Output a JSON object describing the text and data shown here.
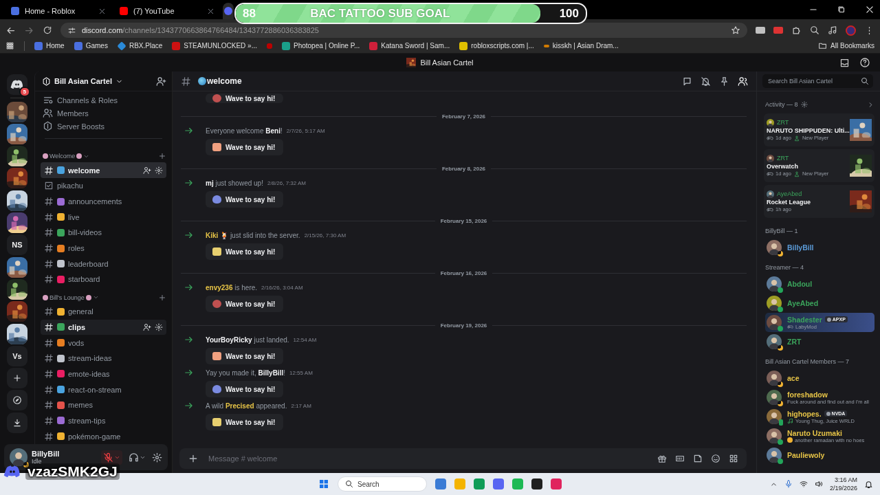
{
  "browser": {
    "tabs": [
      {
        "title": "Home - Roblox",
        "selected": false
      },
      {
        "title": "(7) YouTube",
        "selected": false
      },
      {
        "selected": true
      }
    ],
    "url": {
      "host": "discord.com",
      "path": "/channels/1343770663864766484/1343772886036383825"
    },
    "bookmarks": [
      "Home",
      "Games",
      "RBX.Place",
      "STEAMUNLOCKED »...",
      "Photopea | Online P...",
      "Katana Sword | Sam...",
      "robloxscripts.com |...",
      "kisskh | Asian Dram..."
    ],
    "all_bookmarks": "All Bookmarks"
  },
  "sub_goal": {
    "current": "88",
    "title": "BAC TATTOO SUB GOAL",
    "goal": "100",
    "level": 0.87
  },
  "app_title": "Bill Asian Cartel",
  "server_rail": {
    "badge": "5",
    "servers": [
      {
        "kind": "picture"
      },
      {
        "kind": "picture"
      },
      {
        "kind": "picture"
      },
      {
        "kind": "picture"
      },
      {
        "kind": "picture"
      },
      {
        "kind": "picture"
      },
      {
        "kind": "text",
        "label": "NS"
      },
      {
        "kind": "picture"
      },
      {
        "kind": "picture"
      },
      {
        "kind": "picture"
      },
      {
        "kind": "picture"
      },
      {
        "kind": "text",
        "label": "Vs"
      }
    ]
  },
  "channels": {
    "server_name": "Bill Asian Cartel",
    "menu": [
      "Channels & Roles",
      "Members",
      "Server Boosts"
    ],
    "categories": [
      {
        "name": "Welcome",
        "channels": [
          {
            "name": "welcome",
            "kind": "text",
            "selected": true,
            "hovered": false
          },
          {
            "name": "pikachu",
            "kind": "forum",
            "selected": false,
            "hovered": false
          },
          {
            "name": "announcements",
            "kind": "text",
            "selected": false,
            "hovered": false
          },
          {
            "name": "live",
            "kind": "text",
            "selected": false,
            "hovered": false
          },
          {
            "name": "bill-videos",
            "kind": "text",
            "selected": false,
            "hovered": false
          },
          {
            "name": "roles",
            "kind": "text",
            "selected": false,
            "hovered": false
          },
          {
            "name": "leaderboard",
            "kind": "text",
            "selected": false,
            "hovered": false
          },
          {
            "name": "starboard",
            "kind": "text",
            "selected": false,
            "hovered": false
          }
        ]
      },
      {
        "name": "Bill's Lounge",
        "channels": [
          {
            "name": "general",
            "kind": "text",
            "selected": false,
            "hovered": false
          },
          {
            "name": "clips",
            "kind": "text",
            "selected": false,
            "hovered": true
          },
          {
            "name": "vods",
            "kind": "text",
            "selected": false,
            "hovered": false
          },
          {
            "name": "stream-ideas",
            "kind": "text",
            "selected": false,
            "hovered": false
          },
          {
            "name": "emote-ideas",
            "kind": "text",
            "selected": false,
            "hovered": false
          },
          {
            "name": "react-on-stream",
            "kind": "text",
            "selected": false,
            "hovered": false
          },
          {
            "name": "memes",
            "kind": "text",
            "selected": false,
            "hovered": false
          },
          {
            "name": "stream-tips",
            "kind": "text",
            "selected": false,
            "hovered": false
          },
          {
            "name": "pokémon-game",
            "kind": "text",
            "selected": false,
            "hovered": false
          }
        ]
      }
    ]
  },
  "user": {
    "name": "BillyBill",
    "status": "Idle",
    "presence": {
      "kind": "idle"
    },
    "muted": true
  },
  "chat": {
    "channel": "welcome",
    "placeholder": "Message # welcome",
    "messages": [
      {
        "button": "Wave to say hi!"
      },
      {
        "date": "February 7, 2026",
        "before": "Everyone welcome ",
        "name": "Beni",
        "after": "!",
        "color": "#f2f3f5",
        "time": "2/7/26, 5:17 AM",
        "button": "Wave to say hi!"
      },
      {
        "date": "February 8, 2026",
        "name": "mj",
        "after": " just showed up!",
        "color": "#f2f3f5",
        "time": "2/8/26, 7:32 AM",
        "button": "Wave to say hi!"
      },
      {
        "date": "February 15, 2026",
        "name": "Kiki",
        "after": " 🍹 just slid into the server.",
        "color": "#e8c547",
        "time": "2/15/26, 7:30 AM",
        "button": "Wave to say hi!"
      },
      {
        "date": "February 16, 2026",
        "name": "envy236",
        "after": " is here.",
        "color": "#e8c547",
        "time": "2/16/26, 3:04 AM",
        "button": "Wave to say hi!"
      },
      {
        "date": "February 19, 2026",
        "name": "YourBoyRicky",
        "after": " just landed.",
        "color": "#f2f3f5",
        "time": "12:54 AM",
        "button": "Wave to say hi!"
      },
      {
        "before": "Yay you made it, ",
        "name": "BillyBill",
        "after": "!",
        "color": "#f2f3f5",
        "time": "12:55 AM",
        "button": "Wave to say hi!"
      },
      {
        "before": "A wild ",
        "name": "Precised",
        "after": " appeared.",
        "color": "#e8c547",
        "time": "2:17 AM",
        "button": "Wave to say hi!"
      }
    ]
  },
  "members": {
    "search_placeholder": "Search Bill Asian Cartel",
    "activity_title": "Activity — 8",
    "activities": [
      {
        "user": "ZRT",
        "game": "NARUTO SHIPPUDEN: Ulti...",
        "time": "1d ago",
        "badge": "New Player"
      },
      {
        "user": "ZRT",
        "game": "Overwatch",
        "time": "1d ago",
        "badge": "New Player"
      },
      {
        "user": "AyeAbed",
        "game": "Rocket League",
        "time": "1h ago"
      }
    ],
    "groups": [
      {
        "title": "BillyBill — 1",
        "members": [
          {
            "name": "BillyBill",
            "color": "#5b9bd8",
            "presence": {
              "kind": "idle"
            },
            "highlighted": false
          }
        ]
      },
      {
        "title": "Streamer — 4",
        "members": [
          {
            "name": "Abdoul",
            "color": "#3ba55c",
            "presence": {
              "kind": "online"
            },
            "highlighted": false
          },
          {
            "name": "AyeAbed",
            "color": "#3ba55c",
            "presence": {
              "kind": "online"
            },
            "highlighted": false
          },
          {
            "name": "Shadester",
            "color": "#3ba55c",
            "presence": {
              "kind": "online"
            },
            "tag": "APXP",
            "activity": {
              "kind": "game",
              "text": "LabyMod"
            },
            "highlighted": true
          },
          {
            "name": "ZRT",
            "color": "#3ba55c",
            "presence": {
              "kind": "idle"
            },
            "highlighted": false
          }
        ]
      },
      {
        "title": "Bill Asian Cartel Members — 7",
        "members": [
          {
            "name": "ace",
            "color": "#e8c547",
            "presence": {
              "kind": "idle"
            },
            "highlighted": false
          },
          {
            "name": "foreshadow",
            "color": "#e8c547",
            "presence": {
              "kind": "idle"
            },
            "activity": {
              "kind": "custom",
              "text": "Fuck around and find out and I'm all"
            },
            "highlighted": false
          },
          {
            "name": "highopes.",
            "color": "#e8c547",
            "presence": {
              "kind": "mobile"
            },
            "tag": "NVDA",
            "activity": {
              "kind": "music",
              "text": "Young Thug, Juice WRLD"
            },
            "highlighted": false
          },
          {
            "name": "Naruto Uzumaki",
            "color": "#e8c547",
            "presence": {
              "kind": "online"
            },
            "activity": {
              "kind": "emoji",
              "text": "another ramadan with no hoes"
            },
            "highlighted": false
          },
          {
            "name": "Pauliewoly",
            "color": "#e8c547",
            "presence": {
              "kind": "online"
            },
            "highlighted": false
          }
        ]
      }
    ]
  },
  "streamer_tag": "vzazSMK2GJ",
  "taskbar": {
    "search": "Search",
    "time": "3:16 AM",
    "date": "2/19/2026"
  }
}
